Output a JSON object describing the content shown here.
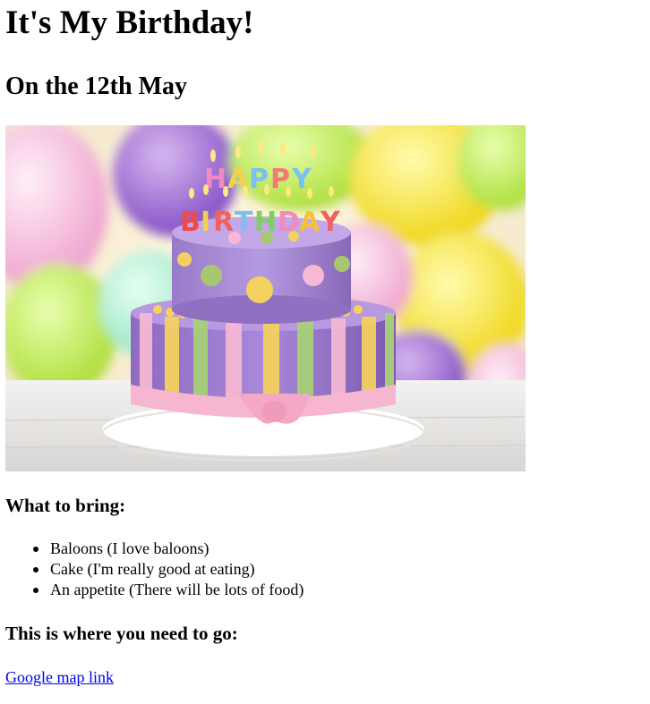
{
  "page": {
    "title": "It's My Birthday!",
    "subtitle": "On the 12th May",
    "image": {
      "icon": "birthday-cake-photo",
      "cake_text": "HAPPY BIRTHDAY"
    },
    "bring_heading": "What to bring:",
    "bring_items": [
      "Baloons (I love baloons)",
      "Cake (I'm really good at eating)",
      "An appetite (There will be lots of food)"
    ],
    "go_heading": "This is where you need to go:",
    "map_link_label": "Google map link"
  },
  "colors": {
    "link": "#0000ee",
    "text": "#000000",
    "background": "#ffffff"
  }
}
